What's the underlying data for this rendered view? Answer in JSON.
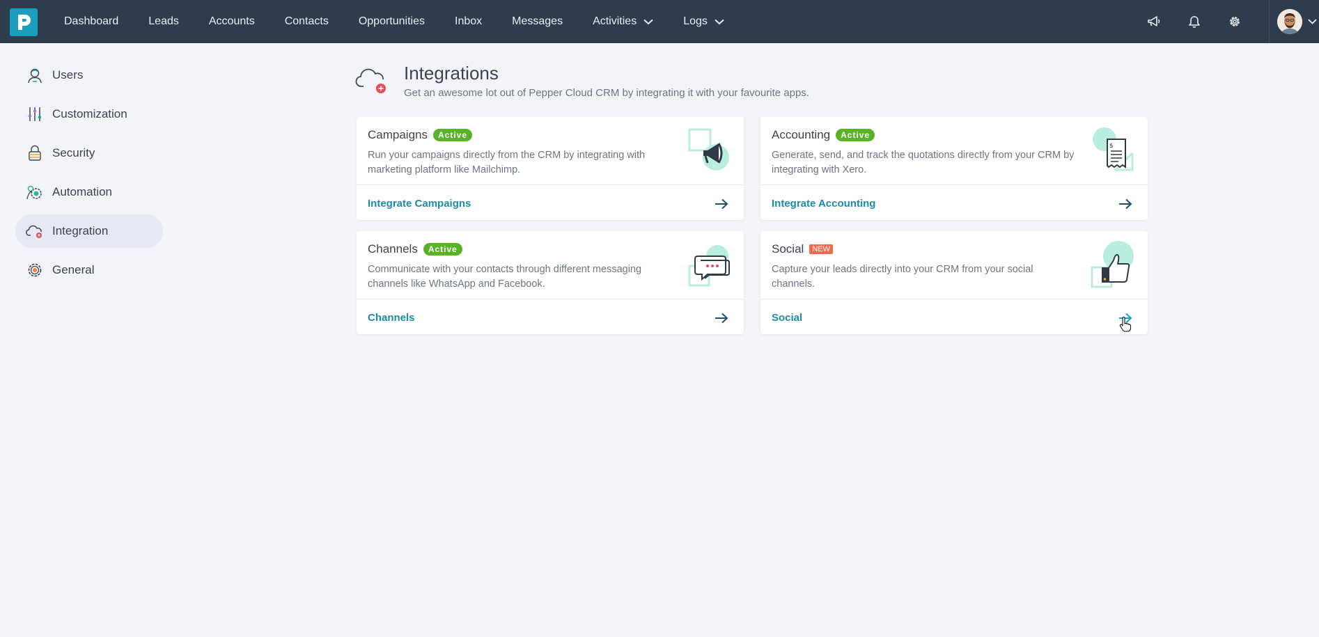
{
  "nav": {
    "logo_letter": "P",
    "items": [
      {
        "label": "Dashboard"
      },
      {
        "label": "Leads"
      },
      {
        "label": "Accounts"
      },
      {
        "label": "Contacts"
      },
      {
        "label": "Opportunities"
      },
      {
        "label": "Inbox"
      },
      {
        "label": "Messages"
      },
      {
        "label": "Activities"
      },
      {
        "label": "Logs"
      }
    ],
    "right_icons": [
      "megaphone-icon",
      "bell-icon",
      "gear-icon",
      "avatar"
    ]
  },
  "sidebar": {
    "items": [
      {
        "label": "Users",
        "icon": "user-icon"
      },
      {
        "label": "Customization",
        "icon": "sliders-icon"
      },
      {
        "label": "Security",
        "icon": "lock-icon"
      },
      {
        "label": "Automation",
        "icon": "automation-icon"
      },
      {
        "label": "Integration",
        "icon": "cloud-icon",
        "active": true
      },
      {
        "label": "General",
        "icon": "settings-icon"
      }
    ]
  },
  "header": {
    "title": "Integrations",
    "subtitle": "Get an awesome lot out of Pepper Cloud CRM by integrating it with your favourite apps."
  },
  "cards": [
    {
      "title": "Campaigns",
      "badge": "Active",
      "description": "Run your campaigns directly from the CRM by integrating with marketing platform like Mailchimp.",
      "link": "Integrate Campaigns"
    },
    {
      "title": "Accounting",
      "badge": "Active",
      "description": "Generate, send, and track the quotations directly from your CRM by integrating with Xero.",
      "link": "Integrate Accounting"
    },
    {
      "title": "Channels",
      "badge": "Active",
      "description": "Communicate with your contacts through different messaging channels like WhatsApp and Facebook.",
      "link": "Channels"
    },
    {
      "title": "Social",
      "badge": "NEW",
      "description": "Capture your leads directly into your CRM from your social channels.",
      "link": "Social"
    }
  ],
  "colors": {
    "navbar": "#2e3d4d",
    "brand": "#1a9fbc",
    "link": "#1a8ca8",
    "badge_active": "#58b326",
    "badge_new": "#f06b4b",
    "illustration_accent": "#b9ede0"
  }
}
